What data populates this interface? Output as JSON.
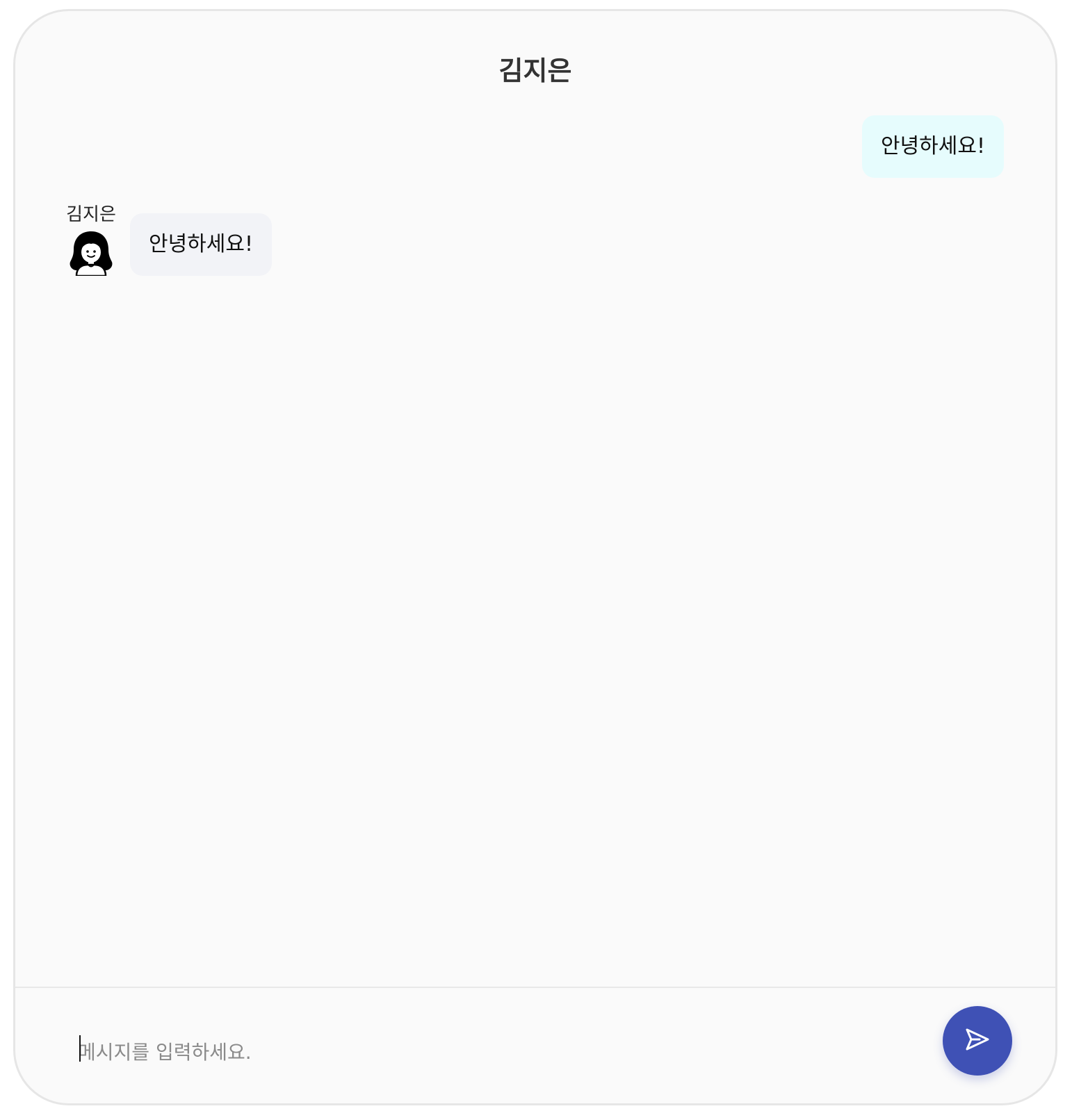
{
  "header": {
    "title": "김지은"
  },
  "messages": [
    {
      "direction": "sent",
      "text": "안녕하세요!"
    },
    {
      "direction": "received",
      "sender": "김지은",
      "avatar_icon": "woman-avatar-icon",
      "text": "안녕하세요!"
    }
  ],
  "composer": {
    "placeholder": "메시지를 입력하세요.",
    "value": "",
    "send_icon": "send-icon"
  },
  "colors": {
    "sent_bubble": "#e6fcfd",
    "received_bubble": "#f2f3f7",
    "send_button": "#3f51b5",
    "window_background": "#fafafa"
  }
}
